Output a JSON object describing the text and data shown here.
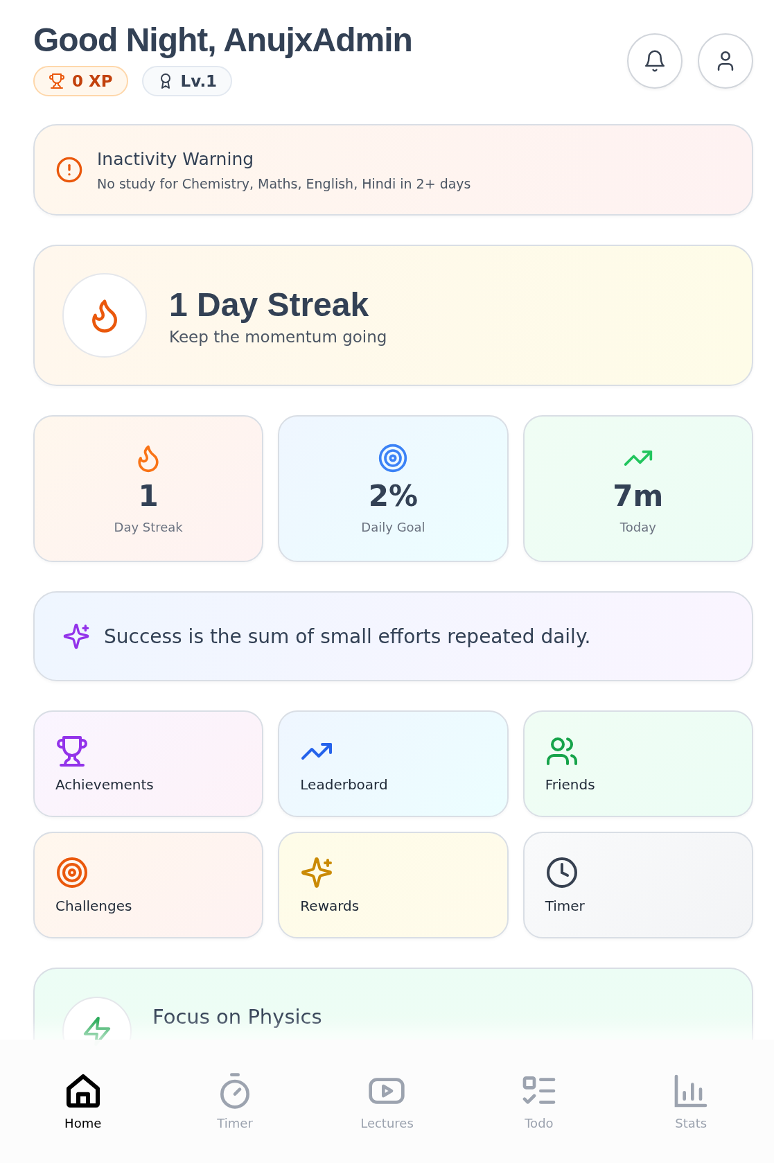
{
  "header": {
    "greeting": "Good Night, AnujxAdmin",
    "xp": "0 XP",
    "level": "Lv.1"
  },
  "warning": {
    "title": "Inactivity Warning",
    "message": "No study for Chemistry, Maths, English, Hindi in 2+ days"
  },
  "streak": {
    "title": "1 Day Streak",
    "subtitle": "Keep the momentum going"
  },
  "stats": [
    {
      "value": "1",
      "label": "Day Streak"
    },
    {
      "value": "2%",
      "label": "Daily Goal"
    },
    {
      "value": "7m",
      "label": "Today"
    }
  ],
  "quote": "Success is the sum of small efforts repeated daily.",
  "features": [
    {
      "label": "Achievements"
    },
    {
      "label": "Leaderboard"
    },
    {
      "label": "Friends"
    },
    {
      "label": "Challenges"
    },
    {
      "label": "Rewards"
    },
    {
      "label": "Timer"
    }
  ],
  "focus": {
    "title": "Focus on Physics"
  },
  "nav": [
    {
      "label": "Home",
      "selected": true
    },
    {
      "label": "Timer",
      "selected": false
    },
    {
      "label": "Lectures",
      "selected": false
    },
    {
      "label": "Todo",
      "selected": false
    },
    {
      "label": "Stats",
      "selected": false
    }
  ]
}
